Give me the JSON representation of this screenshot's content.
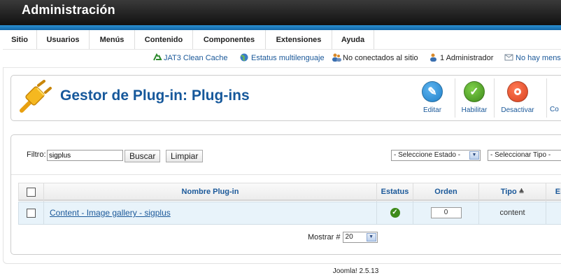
{
  "header": {
    "title": "Administración"
  },
  "menu": {
    "items": [
      {
        "label": "Sitio"
      },
      {
        "label": "Usuarios"
      },
      {
        "label": "Menús"
      },
      {
        "label": "Contenido"
      },
      {
        "label": "Componentes"
      },
      {
        "label": "Extensiones"
      },
      {
        "label": "Ayuda"
      }
    ]
  },
  "status": {
    "cache": "JAT3 Clean Cache",
    "multilang": "Estatus multilenguaje",
    "offline": "No conectados al sitio",
    "admins": "1 Administrador",
    "messages": "No hay mens"
  },
  "toolbar": {
    "title": "Gestor de Plug-in: Plug-ins",
    "edit": "Editar",
    "enable": "Habilitar",
    "disable": "Desactivar",
    "more": "Co"
  },
  "filter": {
    "label": "Filtro:",
    "value": "sigplus",
    "search": "Buscar",
    "clear": "Limpiar",
    "state_select": "- Seleccione Estado -",
    "type_select": "- Seleccionar Tipo -"
  },
  "table": {
    "headers": {
      "name": "Nombre Plug-in",
      "status": "Estatus",
      "order": "Orden",
      "type": "Tipo",
      "extra": "El"
    },
    "rows": [
      {
        "name": "Content - Image gallery - sigplus",
        "status": "enabled",
        "order": "0",
        "type": "content"
      }
    ]
  },
  "pagination": {
    "label": "Mostrar #",
    "value": "20"
  },
  "footer": {
    "version": "Joomla! 2.5.13"
  },
  "colors": {
    "accent": "#16589b",
    "enable_green": "#3d8a1a",
    "disable_red": "#d9411e",
    "edit_blue": "#1e7fc8"
  }
}
